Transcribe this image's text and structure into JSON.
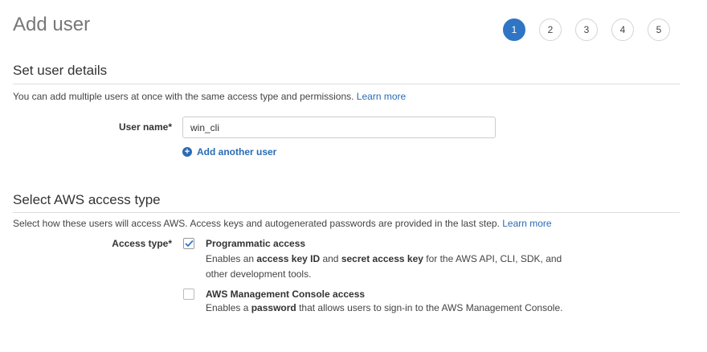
{
  "header": {
    "title": "Add user",
    "steps": [
      "1",
      "2",
      "3",
      "4",
      "5"
    ],
    "active_step": 1
  },
  "user_details": {
    "title": "Set user details",
    "description": "You can add multiple users at once with the same access type and permissions.",
    "learn_more": "Learn more",
    "username_label": "User name*",
    "username_value": "win_cli",
    "add_another_label": "Add another user"
  },
  "access_type": {
    "title": "Select AWS access type",
    "description": "Select how these users will access AWS. Access keys and autogenerated passwords are provided in the last step.",
    "learn_more": "Learn more",
    "label": "Access type*",
    "options": [
      {
        "title": "Programmatic access",
        "checked": true,
        "desc_1": "Enables an ",
        "desc_b1": "access key ID",
        "desc_2": " and ",
        "desc_b2": "secret access key",
        "desc_3": " for the AWS API, CLI, SDK, and other development tools."
      },
      {
        "title": "AWS Management Console access",
        "checked": false,
        "desc_1": "Enables a ",
        "desc_b1": "password",
        "desc_2": " that allows users to sign-in to the AWS Management Console."
      }
    ]
  },
  "colors": {
    "accent": "#2f75c3",
    "link": "#2a6bb4"
  },
  "icons": {
    "add": "plus-circle-icon",
    "check": "checkmark-icon"
  }
}
